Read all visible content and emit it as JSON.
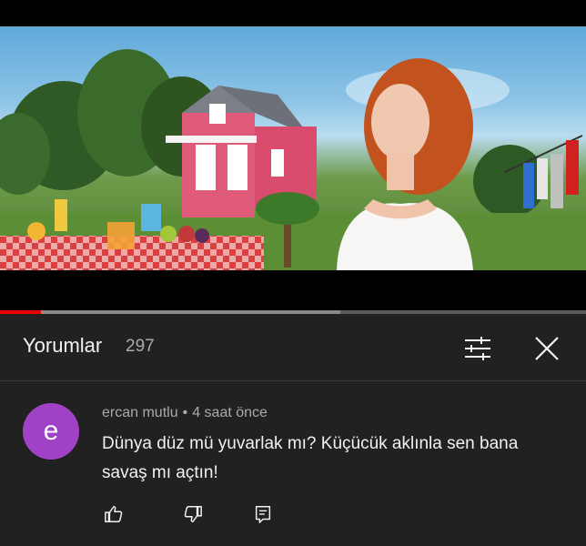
{
  "video": {
    "progress_played": 0.07,
    "progress_buffered": 0.58
  },
  "comments_panel": {
    "title": "Yorumlar",
    "count": "297",
    "filter_icon": "sliders-icon",
    "close_icon": "close-icon"
  },
  "comment": {
    "avatar_letter": "e",
    "avatar_color": "#a142c6",
    "author": "ercan mutlu",
    "separator": "•",
    "time": "4 saat önce",
    "text": "Dünya düz mü yuvarlak mı? Küçücük aklınla sen bana savaş mı açtın!",
    "like_icon": "thumbs-up-icon",
    "dislike_icon": "thumbs-down-icon",
    "reply_icon": "reply-icon"
  },
  "colors": {
    "background": "#212121",
    "progress_red": "#ee0000",
    "muted_text": "#aaaaaa"
  }
}
